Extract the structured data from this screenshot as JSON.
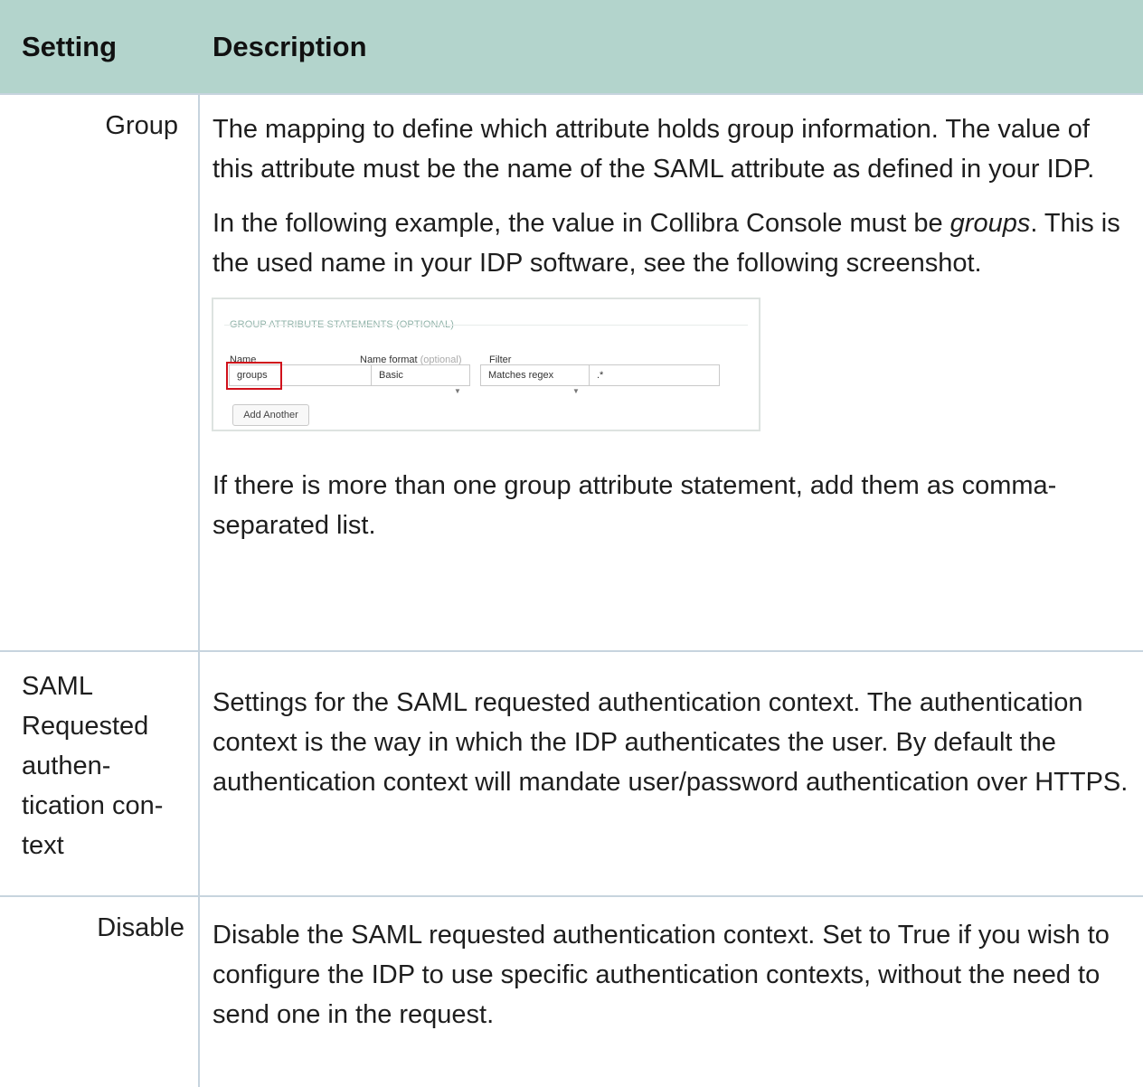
{
  "table": {
    "header": {
      "setting": "Setting",
      "description": "Description"
    },
    "rows": [
      {
        "setting": "Group",
        "description": {
          "p1": "The mapping to define which attribute holds group information. The value of this attribute must be the name of the SAML attribute as defined in your IDP.",
          "p2_before": "In the following example, the value in Collibra Console must be ",
          "p2_em": "groups",
          "p2_after": ". This is the used name in your IDP software, see the following screenshot.",
          "p3": "If there is more than one group attribute statement, add them as comma-separated list."
        }
      },
      {
        "setting": "SAML Requested authen­tication con­text",
        "description": "Settings for the SAML requested authentication context. The authen­tication context is the way in which the IDP authenticates the user. By default the authentication context will mandate user/password authen­tication over HTTPS."
      },
      {
        "setting": "Disable",
        "description": "Disable the SAML requested authentication context. Set to True if you wish to configure the IDP to use specific authentication contexts, without the need to send one in the request."
      }
    ]
  },
  "screenshot": {
    "section_title": "GROUP ATTRIBUTE STATEMENTS (OPTIONAL)",
    "label_name": "Name",
    "label_name_format": "Name format",
    "label_optional": "(optional)",
    "label_filter": "Filter",
    "name_value": "groups",
    "name_format_value": "Basic",
    "filter_type_value": "Matches regex",
    "filter_value": ".*",
    "add_button": "Add Another",
    "highlight_color": "#d0111b"
  }
}
